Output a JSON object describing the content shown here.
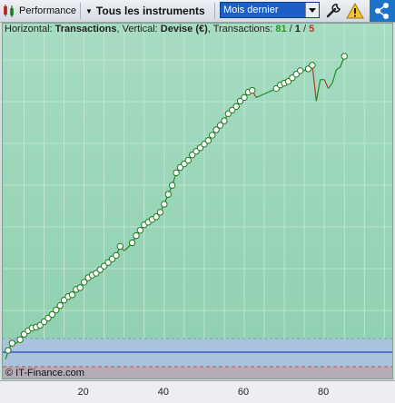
{
  "toolbar": {
    "performance_label": "Performance",
    "instruments_label": "Tous les instruments",
    "period_value": "Mois dernier"
  },
  "info": {
    "horizontal_prefix": "Horizontal: ",
    "horizontal_value": "Transactions",
    "vertical_prefix": ", Vertical: ",
    "vertical_value": "Devise (€)",
    "transactions_prefix": ", Transactions: ",
    "winning": "81",
    "slash1": " / ",
    "neutral": "1",
    "slash2": " / ",
    "losing": "5"
  },
  "copyright": "© IT-Finance.com",
  "colors": {
    "plot_bg_top": "#a6dcc3",
    "plot_bg_bottom": "#8fcfae",
    "gain_line": "#1f8c1f",
    "loss_line": "#b53a2b",
    "zero_band": "#a9c2dd",
    "drawdown_band": "#b5aab8",
    "zero_line": "#2b3fc4"
  },
  "chart_data": {
    "type": "line",
    "x_ticks": [
      20,
      40,
      60,
      80
    ],
    "x_range": [
      0,
      96
    ],
    "equity": [
      2,
      10,
      10,
      14,
      20,
      24,
      27,
      28,
      30,
      34,
      38,
      42,
      47,
      52,
      58,
      62,
      64,
      70,
      72,
      78,
      83,
      86,
      88,
      92,
      96,
      100,
      104,
      108,
      118,
      113,
      117,
      122,
      130,
      136,
      142,
      145,
      148,
      151,
      156,
      165,
      176,
      186,
      200,
      206,
      210,
      214,
      220,
      224,
      228,
      232,
      236,
      242,
      248,
      253,
      258,
      266,
      270,
      274,
      280,
      284,
      290,
      292,
      284,
      286,
      288,
      290,
      292,
      294,
      298,
      300,
      302,
      306,
      310,
      314,
      314,
      316,
      320,
      280,
      304,
      304,
      294,
      300,
      315,
      318,
      330
    ]
  }
}
